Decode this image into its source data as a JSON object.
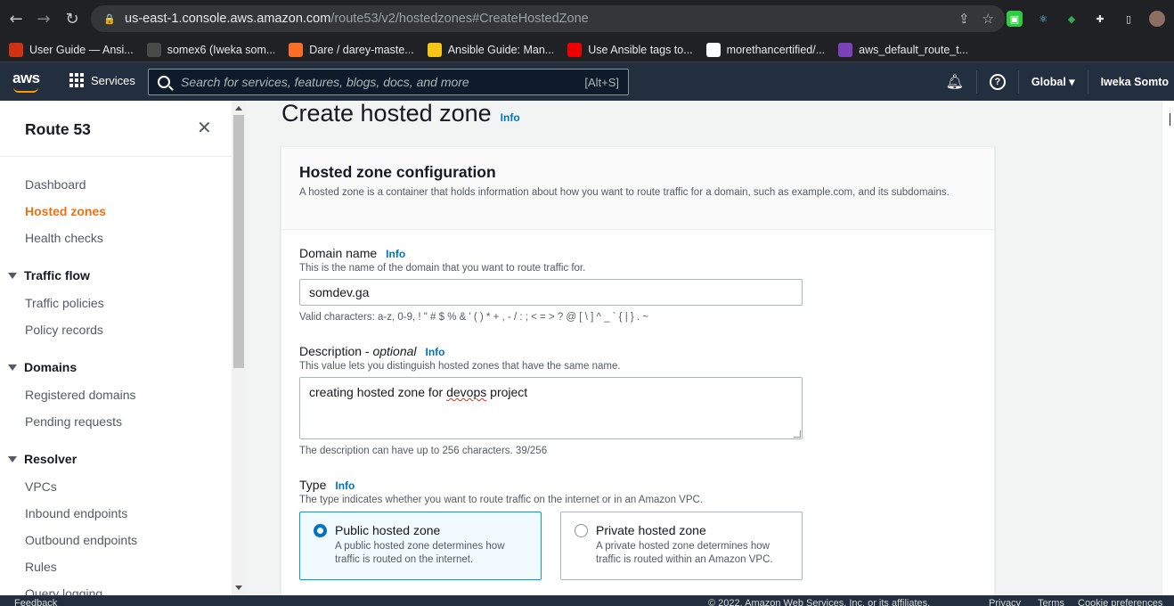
{
  "browser": {
    "url_host": "us-east-1.console.aws.amazon.com",
    "url_path": "/route53/v2/hostedzones#CreateHostedZone",
    "bookmarks": [
      {
        "label": "User Guide — Ansi...",
        "color": "#d13212"
      },
      {
        "label": "somex6 (Iweka som...",
        "color": "#4a4a4a"
      },
      {
        "label": "Dare / darey-maste...",
        "color": "#fc6d26"
      },
      {
        "label": "Ansible Guide: Man...",
        "color": "#f5c518"
      },
      {
        "label": "Use Ansible tags to...",
        "color": "#ee0000"
      },
      {
        "label": "morethancertified/...",
        "color": "#ffffff"
      },
      {
        "label": "aws_default_route_t...",
        "color": "#7b42bc"
      }
    ]
  },
  "aws_header": {
    "logo": "aws",
    "services_label": "Services",
    "search_placeholder": "Search for services, features, blogs, docs, and more",
    "search_shortcut": "[Alt+S]",
    "region": "Global",
    "user": "Iweka Somto"
  },
  "sidenav": {
    "title": "Route 53",
    "items_top": [
      "Dashboard",
      "Hosted zones",
      "Health checks"
    ],
    "active": "Hosted zones",
    "groups": [
      {
        "label": "Traffic flow",
        "items": [
          "Traffic policies",
          "Policy records"
        ]
      },
      {
        "label": "Domains",
        "items": [
          "Registered domains",
          "Pending requests"
        ]
      },
      {
        "label": "Resolver",
        "items": [
          "VPCs",
          "Inbound endpoints",
          "Outbound endpoints",
          "Rules",
          "Query logging"
        ]
      }
    ]
  },
  "main": {
    "page_title": "Create hosted zone",
    "info": "Info",
    "panel_title": "Hosted zone configuration",
    "panel_description": "A hosted zone is a container that holds information about how you want to route traffic for a domain, such as example.com, and its subdomains.",
    "domain": {
      "label": "Domain name",
      "help": "This is the name of the domain that you want to route traffic for.",
      "value": "somdev.ga",
      "constraint": "Valid characters: a-z, 0-9, ! \" # $ % & ' ( ) * + , - / : ; < = > ? @ [ \\ ] ^ _ ` { | } . ~"
    },
    "description": {
      "label": "Description - ",
      "label_optional": "optional",
      "help": "This value lets you distinguish hosted zones that have the same name.",
      "value_prefix": "creating hosted zone for ",
      "value_misspelled": "devops",
      "value_suffix": " project",
      "constraint": "The description can have up to 256 characters. 39/256"
    },
    "type": {
      "label": "Type",
      "help": "The type indicates whether you want to route traffic on the internet or in an Amazon VPC.",
      "options": [
        {
          "title": "Public hosted zone",
          "desc": "A public hosted zone determines how traffic is routed on the internet.",
          "selected": true
        },
        {
          "title": "Private hosted zone",
          "desc": "A private hosted zone determines how traffic is routed within an Amazon VPC.",
          "selected": false
        }
      ]
    }
  },
  "footer": {
    "feedback": "Feedback",
    "copyright": "© 2022, Amazon Web Services, Inc. or its affiliates.",
    "privacy": "Privacy",
    "terms": "Terms",
    "cookie": "Cookie preferences"
  },
  "colors": {
    "accent": "#ec7211",
    "link": "#0073bb",
    "header_bg": "#232f3e",
    "selected_tile": "#f1faff"
  }
}
